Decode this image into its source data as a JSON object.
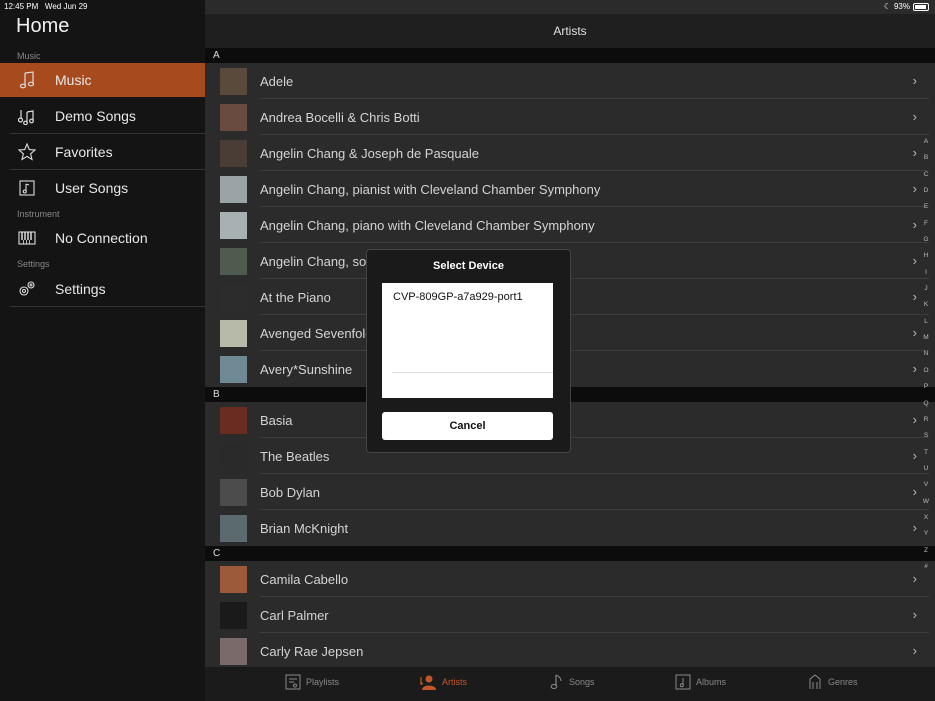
{
  "status": {
    "time": "12:45 PM",
    "date": "Wed Jun 29",
    "battery": "93%",
    "battery_level": 0.93
  },
  "sidebar": {
    "title": "Home",
    "sections": [
      {
        "label": "Music",
        "items": [
          {
            "label": "Music",
            "icon": "music-note-icon",
            "active": true
          },
          {
            "label": "Demo Songs",
            "icon": "demo-songs-icon"
          },
          {
            "label": "Favorites",
            "icon": "star-icon"
          },
          {
            "label": "User Songs",
            "icon": "user-songs-icon"
          }
        ]
      },
      {
        "label": "Instrument",
        "items": [
          {
            "label": "No Connection",
            "icon": "keyboard-icon"
          }
        ]
      },
      {
        "label": "Settings",
        "items": [
          {
            "label": "Settings",
            "icon": "gear-icon"
          }
        ]
      }
    ]
  },
  "header": {
    "title": "Artists"
  },
  "artists": [
    {
      "letter": "A",
      "names": [
        "Adele",
        "Andrea Bocelli & Chris Botti",
        "Angelin Chang & Joseph de Pasquale",
        "Angelin Chang, pianist with Cleveland Chamber Symphony",
        "Angelin Chang, piano with Cleveland Chamber Symphony",
        "Angelin Chang, solo piano",
        "At the Piano",
        "Avenged Sevenfold",
        "Avery*Sunshine"
      ]
    },
    {
      "letter": "B",
      "names": [
        "Basia",
        "The Beatles",
        "Bob Dylan",
        "Brian McKnight"
      ]
    },
    {
      "letter": "C",
      "names": [
        "Camila Cabello",
        "Carl Palmer",
        "Carly Rae Jepsen"
      ]
    }
  ],
  "index_letters": [
    "A",
    "B",
    "C",
    "D",
    "E",
    "F",
    "G",
    "H",
    "I",
    "J",
    "K",
    "L",
    "M",
    "N",
    "O",
    "P",
    "Q",
    "R",
    "S",
    "T",
    "U",
    "V",
    "W",
    "X",
    "Y",
    "Z",
    "#"
  ],
  "tabs": [
    {
      "label": "Playlists",
      "icon": "playlist-icon"
    },
    {
      "label": "Artists",
      "icon": "artist-icon",
      "active": true
    },
    {
      "label": "Songs",
      "icon": "music-note-icon"
    },
    {
      "label": "Albums",
      "icon": "album-icon"
    },
    {
      "label": "Genres",
      "icon": "genres-icon"
    }
  ],
  "dialog": {
    "title": "Select Device",
    "devices": [
      "CVP-809GP-a7a929-port1"
    ],
    "cancel_label": "Cancel"
  },
  "colors": {
    "accent": "#a74a1d",
    "tab_active": "#c0562a"
  }
}
